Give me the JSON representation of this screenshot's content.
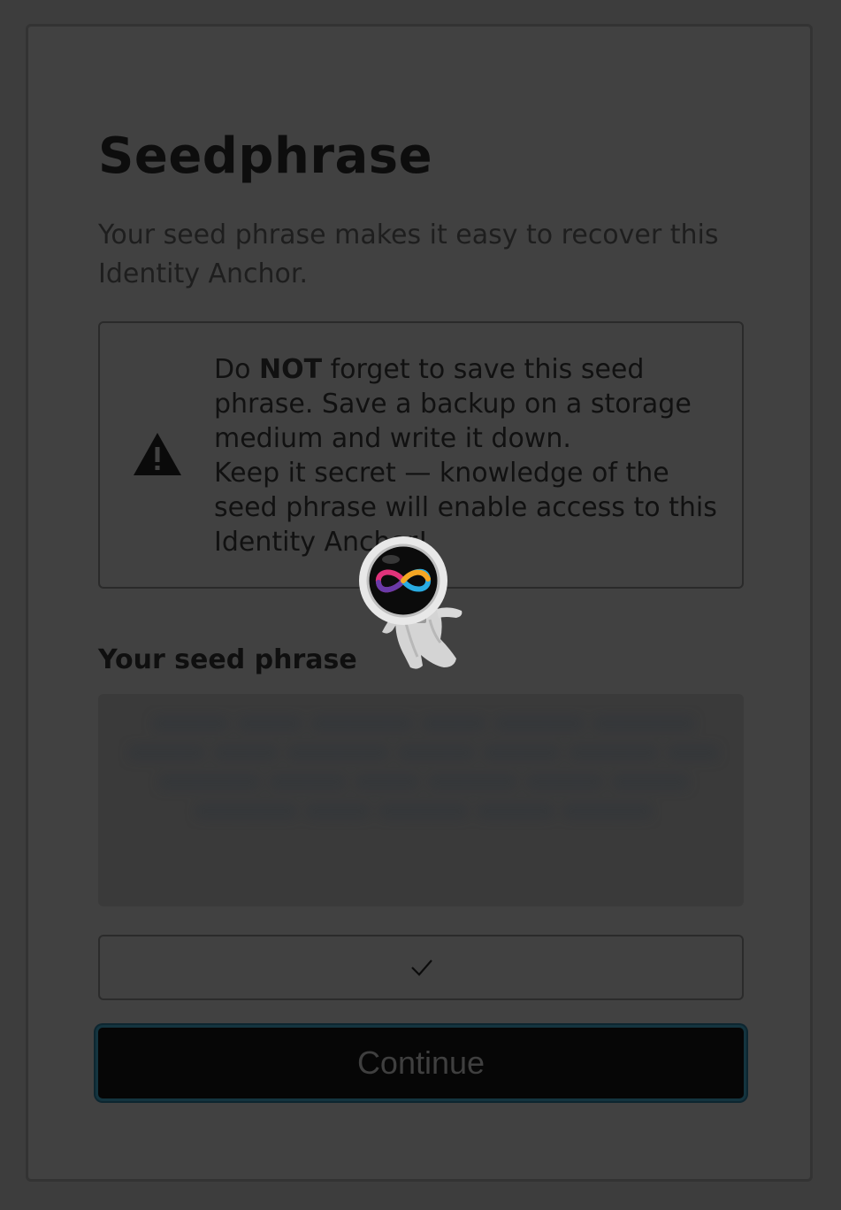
{
  "header": {
    "title": "Seedphrase",
    "subtitle": "Your seed phrase makes it easy to recover this Identity Anchor."
  },
  "warning": {
    "icon": "warning-triangle-icon",
    "prefix": "Do ",
    "emphasis": "NOT",
    "line1_rest": " forget to save this seed phrase. Save a backup on a storage medium and write it down.",
    "line2": "Keep it secret — knowledge of the seed phrase will enable access to this Identity Anchor!"
  },
  "seed": {
    "label": "Your seed phrase",
    "phrase": "xxxxxx xxxxx xxxxxxxx xxxxx xxxxxxx xxxxxxxx xxxxxx xxxxx xxxxxxxx xxxxxx xxxxxx xxxxxxx xxxx xxxxxxxx xxxxxx xxxxx xxxxxxx xxxxxx xxxxxx xxxxxxxx xxxxx xxxxxxx xxxxxx xxxxxxx"
  },
  "copy_button": {
    "icon": "checkmark-icon"
  },
  "actions": {
    "continue_label": "Continue"
  },
  "mascot": {
    "icon": "astronaut-infinity-icon",
    "colors": {
      "ring_magenta": "#e0337a",
      "ring_orange": "#f5a623",
      "ring_blue": "#29abe2",
      "ring_purple": "#6a3aa8"
    }
  }
}
